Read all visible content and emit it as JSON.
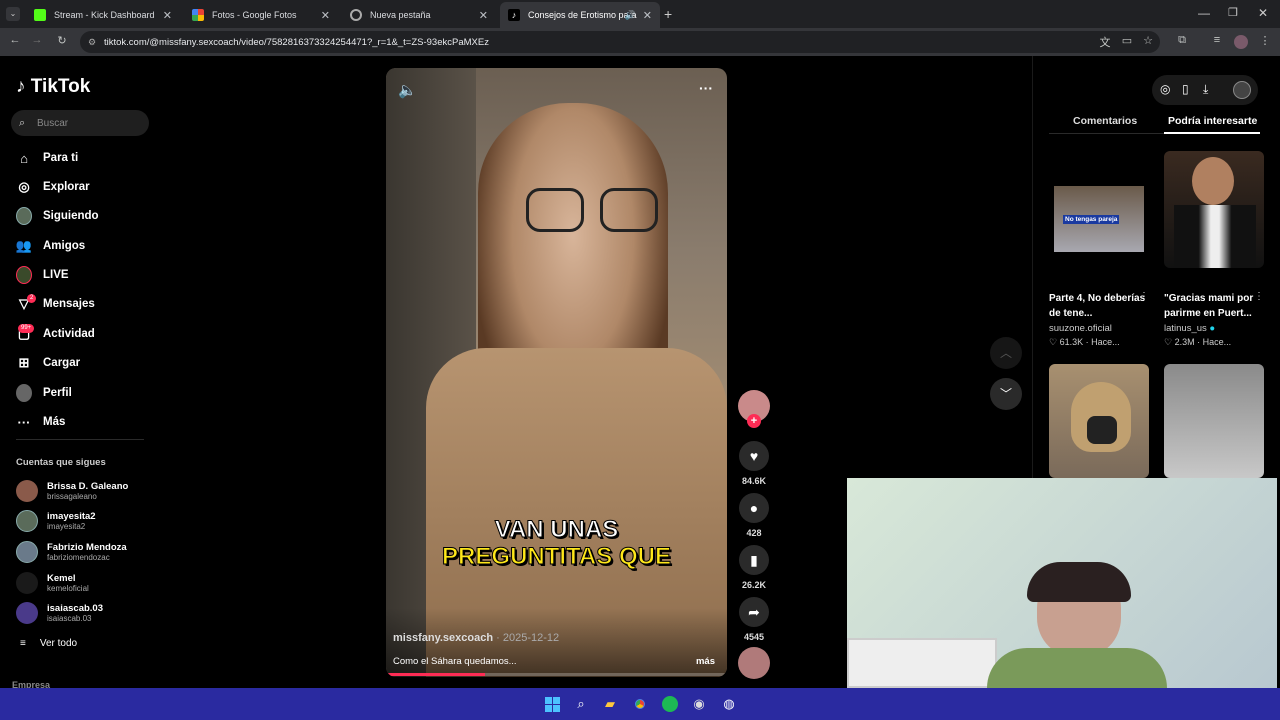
{
  "browser": {
    "tabs": [
      {
        "title": "Stream - Kick Dashboard",
        "active": false
      },
      {
        "title": "Fotos - Google Fotos",
        "active": false
      },
      {
        "title": "Nueva pestaña",
        "active": false
      },
      {
        "title": "Consejos de Erotismo para",
        "active": true
      }
    ],
    "url": "tiktok.com/@missfany.sexcoach/video/7582816373324254471?_r=1&_t=ZS-93ekcPaMXEz"
  },
  "tiktok": {
    "logo": "TikTok",
    "search_placeholder": "Buscar",
    "nav": [
      {
        "label": "Para ti",
        "icon": "home-icon"
      },
      {
        "label": "Explorar",
        "icon": "compass-icon"
      },
      {
        "label": "Siguiendo",
        "icon": "following-avatar-icon"
      },
      {
        "label": "Amigos",
        "icon": "friends-icon"
      },
      {
        "label": "LIVE",
        "icon": "live-icon"
      },
      {
        "label": "Mensajes",
        "icon": "messages-icon",
        "badge": "2"
      },
      {
        "label": "Actividad",
        "icon": "activity-icon",
        "badge": "99+"
      },
      {
        "label": "Cargar",
        "icon": "upload-icon"
      },
      {
        "label": "Perfil",
        "icon": "profile-avatar-icon"
      },
      {
        "label": "Más",
        "icon": "more-icon"
      }
    ],
    "following_heading": "Cuentas que sigues",
    "following": [
      {
        "name": "Brissa D. Galeano",
        "handle": "brissagaleano"
      },
      {
        "name": "imayesita2",
        "handle": "imayesita2"
      },
      {
        "name": "Fabrizio Mendoza",
        "handle": "fabriziomendozac"
      },
      {
        "name": "Kemel",
        "handle": "kemeloficial"
      },
      {
        "name": "isaiascab.03",
        "handle": "isaiascab.03"
      }
    ],
    "see_all": "Ver todo",
    "footer_label": "Empresa",
    "video": {
      "caption_line1": "VAN UNAS",
      "caption_line2": "PREGUNTITAS QUE",
      "author": "missfany.sexcoach",
      "date": "2025-12-12",
      "description": "Como el Sáhara quedamos...",
      "more": "más",
      "progress": 0.29
    },
    "actions": {
      "likes": "84.6K",
      "comments": "428",
      "saves": "26.2K",
      "shares": "4545"
    },
    "panel": {
      "tab_comments": "Comentarios",
      "tab_suggested": "Podría interesarte",
      "recs": [
        {
          "thumb_text": "No tengas pareja",
          "title": "Parte 4, No deberías de tene...",
          "user": "suuzone.oficial",
          "likes": "61.3K",
          "ago": "Hace..."
        },
        {
          "thumb_text": "",
          "title": "\"Gracias mami por parirme en Puert...",
          "user": "latinus_us",
          "likes": "2.3M",
          "ago": "Hace..."
        }
      ]
    }
  },
  "colors": {
    "accent": "#fe2c55",
    "taskbar": "#2a2aa0",
    "chrome_dark": "#202124"
  }
}
